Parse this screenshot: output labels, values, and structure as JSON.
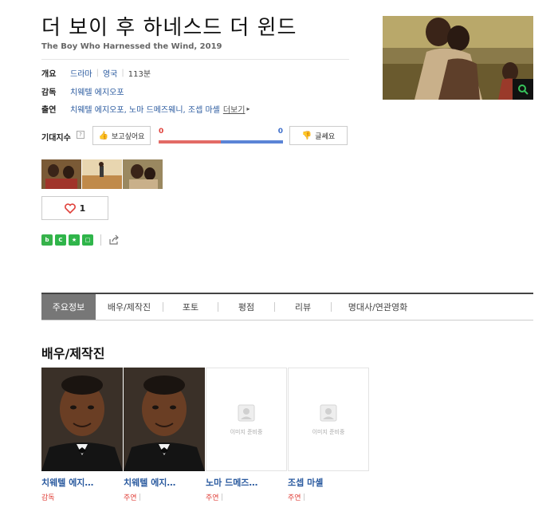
{
  "movie": {
    "title": "더 보이 후 하네스드 더 윈드",
    "subtitle": "The Boy Who Harnessed the Wind, 2019"
  },
  "overview": {
    "label": "개요",
    "genre": "드라마",
    "country": "영국",
    "runtime": "113분"
  },
  "director": {
    "label": "감독",
    "name": "치웨텔 에지오포"
  },
  "cast": {
    "label": "출연",
    "names": "치웨텔 에지오포, 노마 드메즈웨니, 조셉 마셸",
    "more": "더보기"
  },
  "expectation": {
    "label": "기대지수",
    "help": "?",
    "like_label": "보고싶어요",
    "dislike_label": "글쎄요",
    "like_count": "0",
    "dislike_count": "0",
    "like_ratio": 0.5
  },
  "like_box": {
    "count": "1"
  },
  "tabs": [
    {
      "label": "주요정보"
    },
    {
      "label": "배우/제작진"
    },
    {
      "label": "포토"
    },
    {
      "label": "평점"
    },
    {
      "label": "리뷰"
    },
    {
      "label": "명대사/연관영화"
    }
  ],
  "people_section": {
    "title": "배우/제작진",
    "placeholder_text": "이미지 준비중",
    "people": [
      {
        "name": "치웨텔 에지…",
        "role": "감독"
      },
      {
        "name": "치웨텔 에지…",
        "role": "주연"
      },
      {
        "name": "노마 드메즈…",
        "role": "주연"
      },
      {
        "name": "조셉 마셸",
        "role": "주연"
      }
    ]
  },
  "colors": {
    "link": "#2a5a9f",
    "accent_red": "#e0403a",
    "accent_blue": "#3f6fcb",
    "tab_active": "#777777"
  }
}
